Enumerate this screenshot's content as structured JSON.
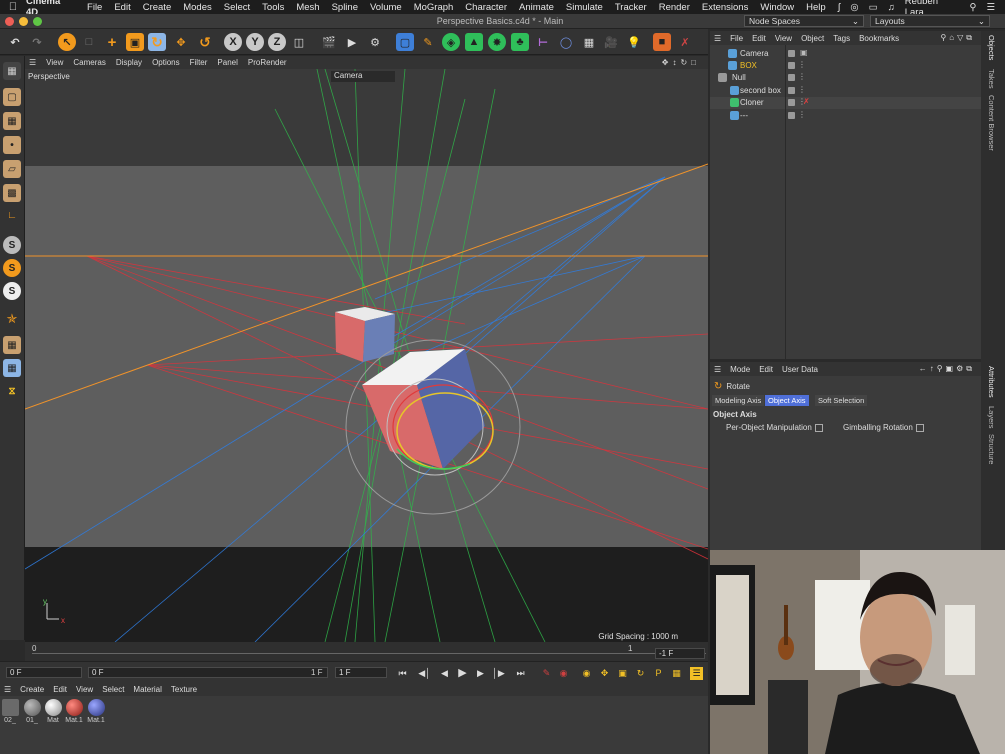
{
  "menubar": {
    "app_name": "Cinema 4D",
    "items": [
      "File",
      "Edit",
      "Create",
      "Modes",
      "Select",
      "Tools",
      "Mesh",
      "Spline",
      "Volume",
      "MoGraph",
      "Character",
      "Animate",
      "Simulate",
      "Tracker",
      "Render",
      "Extensions",
      "Window",
      "Help"
    ],
    "user": "Reuben Lara"
  },
  "window": {
    "title": "Perspective Basics.c4d * - Main",
    "node_spaces": "Node Spaces",
    "layouts": "Layouts"
  },
  "toolbar": {
    "axis_x": "X",
    "axis_y": "Y",
    "axis_z": "Z"
  },
  "viewport": {
    "menu": [
      "View",
      "Cameras",
      "Display",
      "Options",
      "Filter",
      "Panel",
      "ProRender"
    ],
    "label": "Perspective",
    "camera": "Camera",
    "grid_spacing": "Grid Spacing : 1000 m",
    "axis_x": "x",
    "axis_y": "y"
  },
  "timeline": {
    "start": "0",
    "mark_1": "1",
    "end_field": "-1 F",
    "current_frame": "0 F",
    "min_frame": "0 F",
    "max_frame_a": "1 F",
    "max_frame_b": "1 F"
  },
  "material_manager": {
    "menu": [
      "Create",
      "Edit",
      "View",
      "Select",
      "Material",
      "Texture"
    ],
    "materials": [
      {
        "name": "02_",
        "color": "#6a6a6a"
      },
      {
        "name": "01_",
        "color": "#8a8a8a"
      },
      {
        "name": "Mat",
        "color": "#cfcfcf"
      },
      {
        "name": "Mat.1",
        "color": "#c0302a"
      },
      {
        "name": "Mat.1",
        "color": "#4a56b8"
      }
    ]
  },
  "object_manager": {
    "menu": [
      "File",
      "Edit",
      "View",
      "Object",
      "Tags",
      "Bookmarks"
    ],
    "objects": [
      {
        "name": "Camera",
        "color": "#dddddd",
        "icon": "#5aa0d8"
      },
      {
        "name": "BOX",
        "color": "#f2c026",
        "icon": "#5aa0d8"
      },
      {
        "name": "Null",
        "color": "#dddddd",
        "icon": "#9a9a9a"
      },
      {
        "name": "second box",
        "color": "#dddddd",
        "icon": "#5aa0d8"
      },
      {
        "name": "Cloner",
        "color": "#dddddd",
        "icon": "#3fbf6e"
      },
      {
        "name": "---",
        "color": "#dddddd",
        "icon": "#5aa0d8"
      }
    ]
  },
  "attributes": {
    "menu": [
      "Mode",
      "Edit",
      "User Data"
    ],
    "tool": "Rotate",
    "tabs": [
      "Modeling Axis",
      "Object Axis",
      "Soft Selection"
    ],
    "active_tab": "Object Axis",
    "section": "Object Axis",
    "per_object": "Per-Object Manipulation",
    "gimballing": "Gimballing Rotation"
  },
  "side_tabs": [
    "Objects",
    "Takes",
    "Content Browser",
    "Attributes",
    "Layers",
    "Structure"
  ]
}
